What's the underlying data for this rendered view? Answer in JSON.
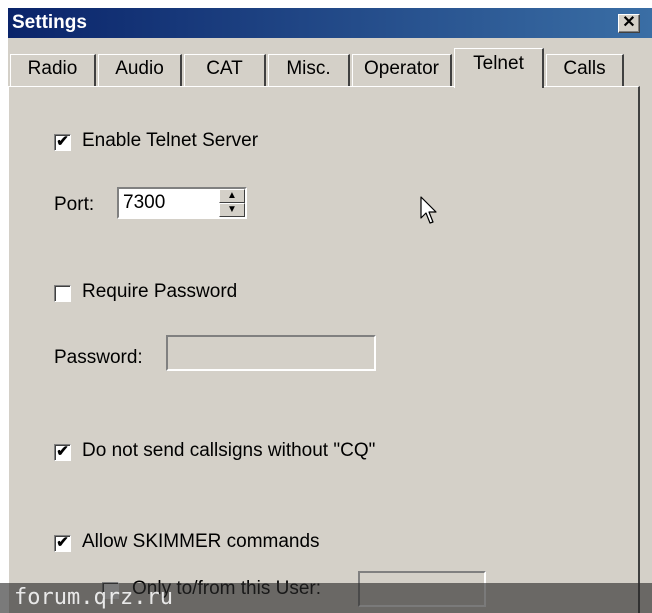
{
  "window": {
    "title": "Settings",
    "close_label": "✕"
  },
  "tabs": [
    {
      "label": "Radio",
      "active": false
    },
    {
      "label": "Audio",
      "active": false
    },
    {
      "label": "CAT",
      "active": false
    },
    {
      "label": "Misc.",
      "active": false
    },
    {
      "label": "Operator",
      "active": false
    },
    {
      "label": "Telnet",
      "active": true
    },
    {
      "label": "Calls",
      "active": false
    }
  ],
  "telnet": {
    "enable_server": {
      "label": "Enable Telnet Server",
      "checked": true,
      "mark": "✔"
    },
    "port": {
      "label": "Port:",
      "value": "7300"
    },
    "require_password": {
      "label": "Require Password",
      "checked": false,
      "mark": ""
    },
    "password": {
      "label": "Password:",
      "value": ""
    },
    "no_callsigns_without_cq": {
      "label": "Do not send callsigns without \"CQ\"",
      "checked": true,
      "mark": "✔"
    },
    "allow_skimmer": {
      "label": "Allow SKIMMER commands",
      "checked": true,
      "mark": "✔"
    },
    "only_user": {
      "label": "Only to/from this User:",
      "checked": false,
      "mark": "",
      "value": ""
    }
  },
  "watermark": {
    "text": "forum.qrz.ru"
  },
  "icons": {
    "close": "close-icon",
    "cursor": "mouse-cursor-icon",
    "spin_up": "arrow-up-icon",
    "spin_down": "arrow-down-icon",
    "check": "checkmark-icon"
  },
  "colors": {
    "titlebar_start": "#0a246a",
    "titlebar_end": "#3a6ea5",
    "face": "#d4d0c8"
  }
}
